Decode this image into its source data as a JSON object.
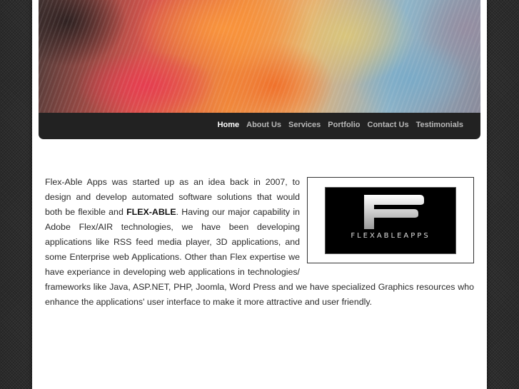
{
  "nav": {
    "items": [
      {
        "label": "Home",
        "active": true
      },
      {
        "label": "About Us",
        "active": false
      },
      {
        "label": "Services",
        "active": false
      },
      {
        "label": "Portfolio",
        "active": false
      },
      {
        "label": "Contact Us",
        "active": false
      },
      {
        "label": "Testimonials",
        "active": false
      }
    ]
  },
  "logo": {
    "text": "FLEXABLEAPPS"
  },
  "content": {
    "part1": "Flex-Able Apps was started up as an idea back in 2007, to design and develop automated software solutions that would both be flexible and ",
    "emphasis": "FLEX-ABLE",
    "part2": ". Having our major capability in Adobe Flex/AIR technologies, we have been developing applications like RSS feed media player, 3D applications, and some Enterprise web Applications. Other than Flex expertise we have experiance in developing web applications in technologies/ frameworks like Java, ASP.NET, PHP, Joomla, Word Press and we have specialized Graphics resources who enhance the applications' user interface to make it more attractive and user friendly."
  },
  "colors": {
    "nav_bg": "#222222",
    "nav_text": "#b8b8b8",
    "nav_active": "#ffffff"
  }
}
